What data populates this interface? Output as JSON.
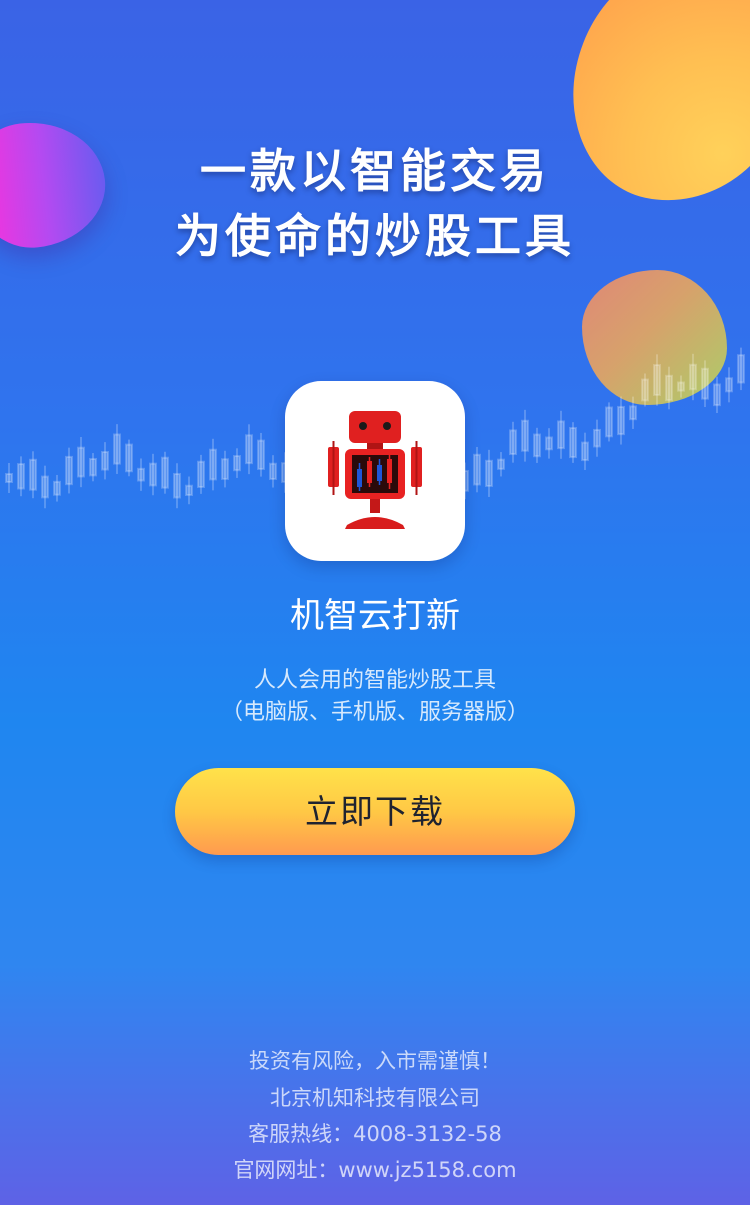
{
  "banner": {
    "headline_line1": "一款以智能交易",
    "headline_line2": "为使命的炒股工具"
  },
  "app": {
    "icon": "robot-candlestick-icon",
    "name": "机智云打新",
    "tagline": "人人会用的智能炒股工具",
    "platforms": "（电脑版、手机版、服务器版）"
  },
  "actions": {
    "download_label": "立即下载"
  },
  "footer": {
    "risk_warning": "投资有风险，入市需谨慎！",
    "company": "北京机知科技有限公司",
    "hotline": "客服热线：4008-3132-58",
    "website": "官网网址：www.jz5158.com"
  },
  "colors": {
    "accent_button_top": "#ffe24a",
    "accent_button_bottom": "#ff9a4f",
    "background_top": "#3a63e6",
    "background_bottom": "#5e62e6"
  }
}
